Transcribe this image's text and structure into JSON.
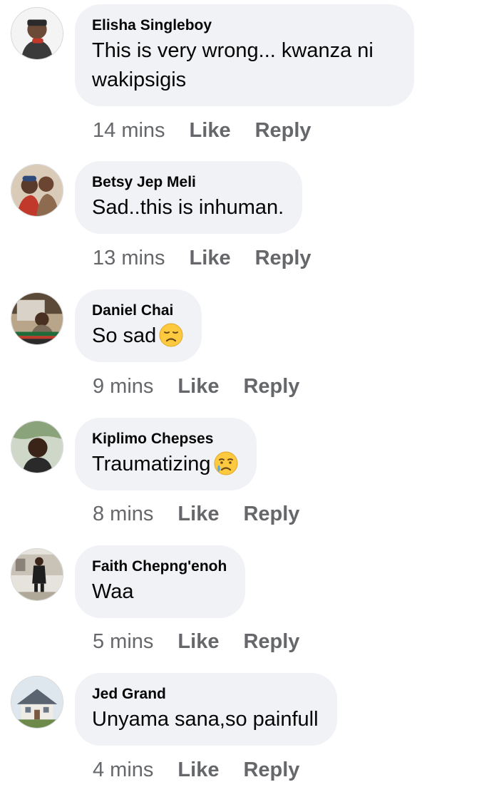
{
  "comments": [
    {
      "author": "Elisha Singleboy",
      "text": "This is very wrong... kwanza ni wakipsigis",
      "time": "14 mins",
      "like_label": "Like",
      "reply_label": "Reply"
    },
    {
      "author": "Betsy Jep Meli",
      "text": "Sad..this is inhuman.",
      "time": "13 mins",
      "like_label": "Like",
      "reply_label": "Reply"
    },
    {
      "author": "Daniel Chai",
      "text": "So sad",
      "emoji": "disappointed-face-emoji",
      "time": "9 mins",
      "like_label": "Like",
      "reply_label": "Reply"
    },
    {
      "author": "Kiplimo Chepses",
      "text": "Traumatizing",
      "emoji": "crying-face-emoji",
      "time": "8 mins",
      "like_label": "Like",
      "reply_label": "Reply"
    },
    {
      "author": "Faith Chepng'enoh",
      "text": "Waa",
      "time": "5 mins",
      "like_label": "Like",
      "reply_label": "Reply"
    },
    {
      "author": "Jed Grand",
      "text": "Unyama sana,so painfull",
      "time": "4 mins",
      "like_label": "Like",
      "reply_label": "Reply"
    }
  ],
  "colors": {
    "bubble_background": "#f0f2f5",
    "author_text": "#050505",
    "meta_text": "#65676b"
  }
}
